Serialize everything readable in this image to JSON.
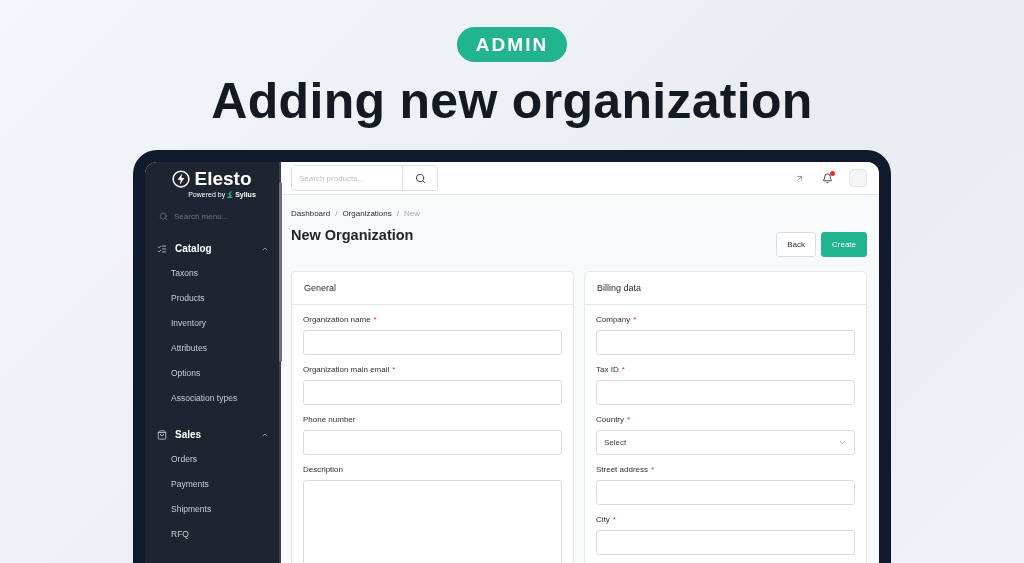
{
  "badge": "ADMIN",
  "headline": "Adding new organization",
  "sidebar": {
    "logo": "Elesto",
    "powered_by": "Powered by",
    "powered_brand": "Sylius",
    "search": {
      "placeholder": "Search menu..."
    },
    "sections": [
      {
        "label": "Catalog",
        "kind": "catalog",
        "expanded": true,
        "items": [
          "Taxons",
          "Products",
          "Inventory",
          "Attributes",
          "Options",
          "Association types"
        ]
      },
      {
        "label": "Sales",
        "kind": "sales",
        "expanded": true,
        "items": [
          "Orders",
          "Payments",
          "Shipments",
          "RFQ"
        ]
      }
    ]
  },
  "topbar": {
    "search": {
      "placeholder": "Search products..."
    },
    "has_notification": true
  },
  "breadcrumb": [
    {
      "label": "Dashboard",
      "current": false
    },
    {
      "label": "Organizations",
      "current": false
    },
    {
      "label": "New",
      "current": true
    }
  ],
  "breadcrumb_separator": "/",
  "title": "New Organization",
  "buttons": [
    {
      "label": "Back",
      "kind": "secondary"
    },
    {
      "label": "Create",
      "kind": "primary"
    }
  ],
  "required_mark": "*",
  "cards": [
    {
      "title": "General",
      "fields": [
        {
          "label": "Organization name",
          "required": true,
          "kind": "text"
        },
        {
          "label": "Organization main email",
          "required": true,
          "kind": "text"
        },
        {
          "label": "Phone number",
          "required": false,
          "kind": "text"
        },
        {
          "label": "Description",
          "required": false,
          "kind": "textarea"
        }
      ]
    },
    {
      "title": "Billing data",
      "fields": [
        {
          "label": "Company",
          "required": true,
          "kind": "text"
        },
        {
          "label": "Tax ID",
          "required": true,
          "kind": "text"
        },
        {
          "label": "Country",
          "required": true,
          "kind": "select",
          "placeholder": "Select"
        },
        {
          "label": "Street address",
          "required": true,
          "kind": "text"
        },
        {
          "label": "City",
          "required": true,
          "kind": "text"
        }
      ]
    }
  ]
}
